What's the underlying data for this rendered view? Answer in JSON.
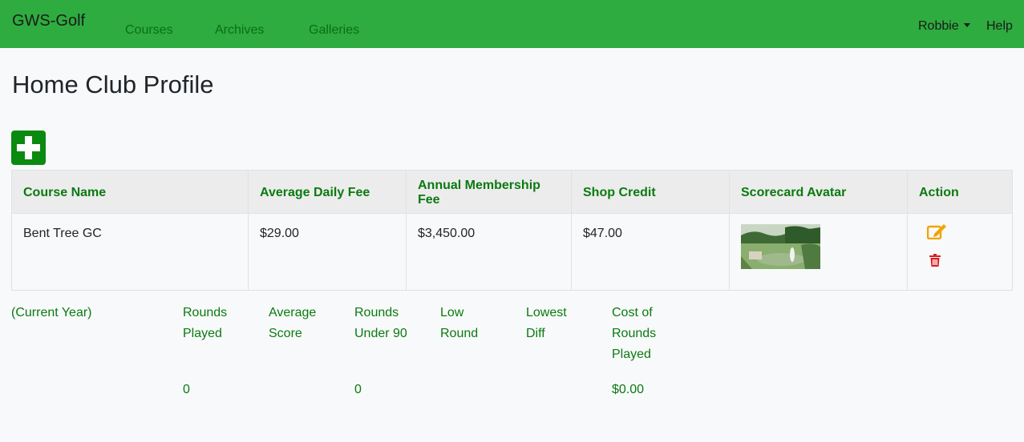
{
  "navbar": {
    "brand": "GWS-Golf",
    "links": [
      "Courses",
      "Archives",
      "Galleries"
    ],
    "user": "Robbie",
    "help": "Help"
  },
  "page": {
    "title": "Home Club Profile"
  },
  "add_button": {
    "icon": "plus-icon"
  },
  "table": {
    "headers": [
      "Course Name",
      "Average Daily Fee",
      "Annual Membership Fee",
      "Shop Credit",
      "Scorecard Avatar",
      "Action"
    ],
    "rows": [
      {
        "course_name": "Bent Tree GC",
        "daily_fee": "$29.00",
        "membership_fee": "$3,450.00",
        "shop_credit": "$47.00",
        "avatar_icon": "golf-course-image",
        "actions": [
          "edit-icon",
          "trash-icon"
        ]
      }
    ]
  },
  "stats": {
    "period": "(Current Year)",
    "labels": {
      "rounds_played": [
        "Rounds",
        "Played"
      ],
      "average_score": [
        "Average",
        "Score"
      ],
      "rounds_under_90": [
        "Rounds",
        "Under 90"
      ],
      "low_round": [
        "Low",
        "Round"
      ],
      "lowest_diff": [
        "Lowest",
        "Diff"
      ],
      "cost_of_rounds": [
        "Cost of",
        "Rounds",
        "Played"
      ]
    },
    "values": {
      "rounds_played": "0",
      "rounds_under_90": "0",
      "cost_of_rounds": "$0.00"
    }
  },
  "colors": {
    "navbar": "#2eac3f",
    "accent_green": "#0a7a10",
    "edit": "#f0a500",
    "delete": "#dc1e1e"
  }
}
